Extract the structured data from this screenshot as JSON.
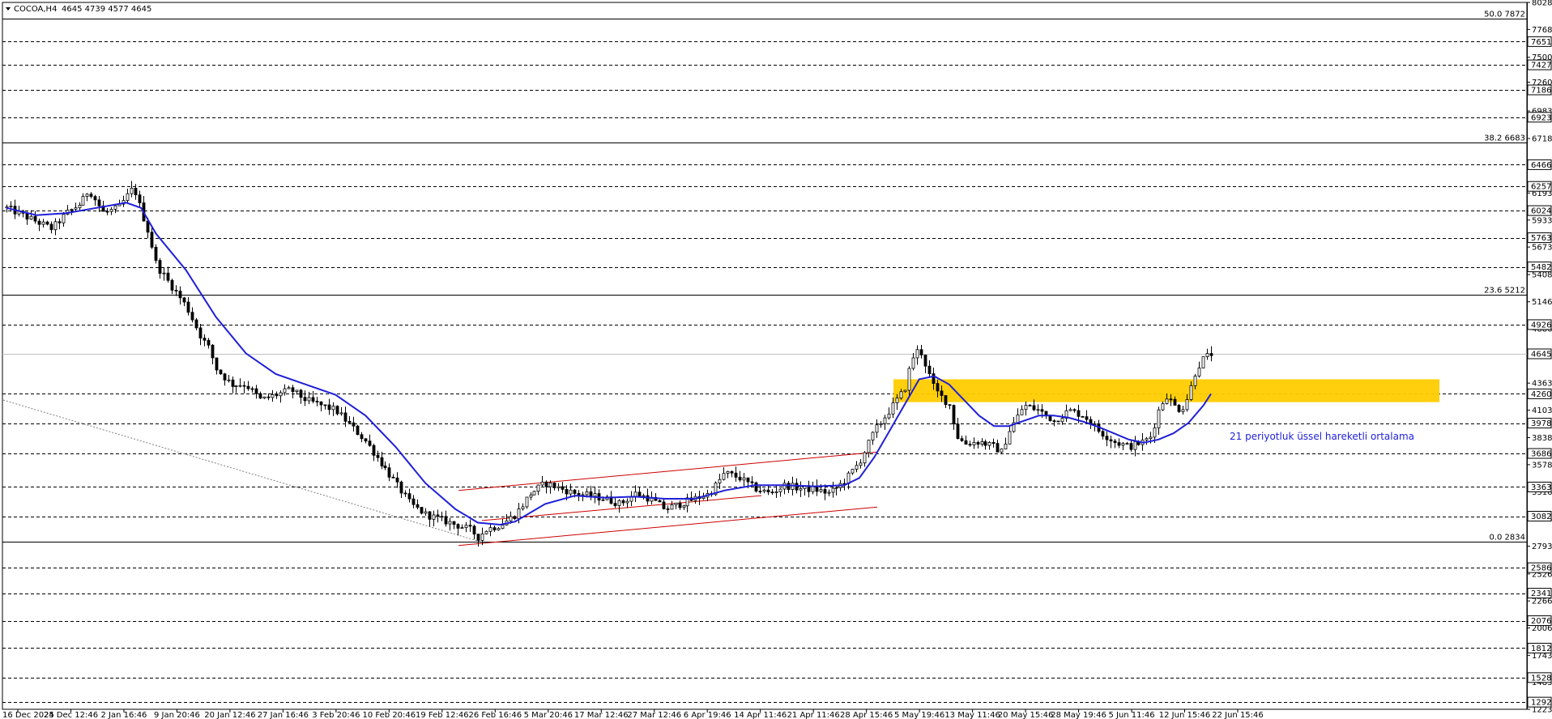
{
  "header": {
    "symbol": "COCOA,H4",
    "ohlc": "4645 4739 4577 4645"
  },
  "chart_data": {
    "type": "candlestick",
    "title": "",
    "ylim": [
      1223,
      8028
    ],
    "y_ticks": [
      8028,
      7768,
      7500,
      7260,
      6983,
      6718,
      6193,
      5933,
      5673,
      5408,
      5146,
      4886,
      4363,
      4103,
      3838,
      3578,
      3316,
      3058,
      2793,
      2526,
      2266,
      2006,
      1743,
      1483,
      1223
    ],
    "x_ticks": [
      "16 Dec 2025",
      "24 Dec 12:46",
      "2 Jan 16:46",
      "9 Jan 20:46",
      "20 Jan 12:46",
      "27 Jan 16:46",
      "3 Feb 20:46",
      "10 Feb 20:46",
      "19 Feb 12:46",
      "26 Feb 16:46",
      "5 Mar 20:46",
      "17 Mar 12:46",
      "27 Mar 12:46",
      "6 Apr 19:46",
      "14 Apr 11:46",
      "21 Apr 11:46",
      "28 Apr 15:46",
      "5 May 19:46",
      "13 May 11:46",
      "20 May 15:46",
      "28 May 19:46",
      "5 Jun 11:46",
      "12 Jun 15:46",
      "22 Jun 15:46"
    ],
    "horizontal_levels": [
      7651,
      7427,
      7186,
      6923,
      6466,
      6257,
      6024,
      5763,
      5482,
      4926,
      4260,
      3978,
      3686,
      3363,
      3082,
      2586,
      2341,
      2076,
      1812,
      1528,
      1292
    ],
    "current_price": 4645,
    "fibonacci": [
      {
        "label": "50.0 7872",
        "value": 7872
      },
      {
        "label": "38.2 6683",
        "value": 6683
      },
      {
        "label": "23.6 5212",
        "value": 5212
      },
      {
        "label": "0.0 2834",
        "value": 2834
      }
    ],
    "zone": {
      "from": 4180,
      "to": 4400,
      "color": "#ffcc00"
    },
    "ema_label": "21 periyotluk üssel hareketli ortalama",
    "ema_color": "#1f1fd8",
    "channel_color": "#cc0000",
    "price_path": [
      [
        0,
        6050
      ],
      [
        3,
        5950
      ],
      [
        6,
        5850
      ],
      [
        8,
        6000
      ],
      [
        10,
        6100
      ],
      [
        11,
        6230
      ],
      [
        13,
        6000
      ],
      [
        15,
        6050
      ],
      [
        16,
        6150
      ],
      [
        17,
        6250
      ],
      [
        18,
        6020
      ],
      [
        19,
        5800
      ],
      [
        20,
        5500
      ],
      [
        21,
        5400
      ],
      [
        22,
        5300
      ],
      [
        23,
        5200
      ],
      [
        24,
        5100
      ],
      [
        26,
        4800
      ],
      [
        27,
        4700
      ],
      [
        28,
        4500
      ],
      [
        30,
        4350
      ],
      [
        32,
        4350
      ],
      [
        34,
        4200
      ],
      [
        36,
        4250
      ],
      [
        38,
        4300
      ],
      [
        40,
        4200
      ],
      [
        42,
        4150
      ],
      [
        44,
        4100
      ],
      [
        46,
        3950
      ],
      [
        48,
        3800
      ],
      [
        50,
        3600
      ],
      [
        52,
        3400
      ],
      [
        54,
        3200
      ],
      [
        56,
        3100
      ],
      [
        58,
        3050
      ],
      [
        60,
        3000
      ],
      [
        62,
        2950
      ],
      [
        63,
        2880
      ],
      [
        64,
        2950
      ],
      [
        66,
        3000
      ],
      [
        68,
        3100
      ],
      [
        70,
        3300
      ],
      [
        72,
        3400
      ],
      [
        74,
        3350
      ],
      [
        76,
        3300
      ],
      [
        78,
        3280
      ],
      [
        80,
        3250
      ],
      [
        82,
        3200
      ],
      [
        84,
        3300
      ],
      [
        86,
        3250
      ],
      [
        88,
        3150
      ],
      [
        90,
        3200
      ],
      [
        92,
        3250
      ],
      [
        94,
        3300
      ],
      [
        96,
        3500
      ],
      [
        98,
        3450
      ],
      [
        100,
        3350
      ],
      [
        102,
        3300
      ],
      [
        104,
        3380
      ],
      [
        106,
        3350
      ],
      [
        108,
        3340
      ],
      [
        110,
        3300
      ],
      [
        112,
        3420
      ],
      [
        114,
        3600
      ],
      [
        116,
        3900
      ],
      [
        118,
        4100
      ],
      [
        120,
        4300
      ],
      [
        121,
        4600
      ],
      [
        122,
        4700
      ],
      [
        123,
        4500
      ],
      [
        124,
        4300
      ],
      [
        126,
        4150
      ],
      [
        127,
        3850
      ],
      [
        128,
        3780
      ],
      [
        130,
        3800
      ],
      [
        132,
        3750
      ],
      [
        133,
        3700
      ],
      [
        134,
        3900
      ],
      [
        136,
        4150
      ],
      [
        138,
        4100
      ],
      [
        140,
        4000
      ],
      [
        142,
        4100
      ],
      [
        144,
        4050
      ],
      [
        146,
        3900
      ],
      [
        148,
        3800
      ],
      [
        150,
        3750
      ],
      [
        152,
        3800
      ],
      [
        153,
        3850
      ],
      [
        154,
        4100
      ],
      [
        155,
        4250
      ],
      [
        156,
        4150
      ],
      [
        157,
        4100
      ],
      [
        158,
        4250
      ],
      [
        159,
        4500
      ],
      [
        160,
        4600
      ],
      [
        161,
        4645
      ]
    ],
    "ema_path": [
      [
        0,
        6050
      ],
      [
        4,
        5980
      ],
      [
        8,
        6000
      ],
      [
        12,
        6050
      ],
      [
        16,
        6100
      ],
      [
        18,
        6050
      ],
      [
        20,
        5800
      ],
      [
        24,
        5450
      ],
      [
        28,
        5000
      ],
      [
        32,
        4650
      ],
      [
        36,
        4450
      ],
      [
        40,
        4350
      ],
      [
        44,
        4250
      ],
      [
        48,
        4050
      ],
      [
        52,
        3750
      ],
      [
        56,
        3400
      ],
      [
        60,
        3150
      ],
      [
        63,
        3020
      ],
      [
        66,
        3000
      ],
      [
        68,
        3030
      ],
      [
        72,
        3200
      ],
      [
        76,
        3280
      ],
      [
        80,
        3260
      ],
      [
        84,
        3270
      ],
      [
        88,
        3250
      ],
      [
        92,
        3250
      ],
      [
        96,
        3330
      ],
      [
        100,
        3380
      ],
      [
        104,
        3380
      ],
      [
        108,
        3370
      ],
      [
        112,
        3380
      ],
      [
        114,
        3450
      ],
      [
        116,
        3650
      ],
      [
        118,
        3900
      ],
      [
        120,
        4150
      ],
      [
        122,
        4400
      ],
      [
        124,
        4430
      ],
      [
        126,
        4350
      ],
      [
        128,
        4200
      ],
      [
        130,
        4050
      ],
      [
        132,
        3950
      ],
      [
        134,
        3950
      ],
      [
        136,
        4000
      ],
      [
        138,
        4050
      ],
      [
        140,
        4050
      ],
      [
        142,
        4030
      ],
      [
        144,
        3990
      ],
      [
        146,
        3940
      ],
      [
        148,
        3880
      ],
      [
        150,
        3820
      ],
      [
        152,
        3790
      ],
      [
        154,
        3820
      ],
      [
        156,
        3880
      ],
      [
        158,
        3980
      ],
      [
        160,
        4150
      ],
      [
        161,
        4260
      ]
    ]
  }
}
